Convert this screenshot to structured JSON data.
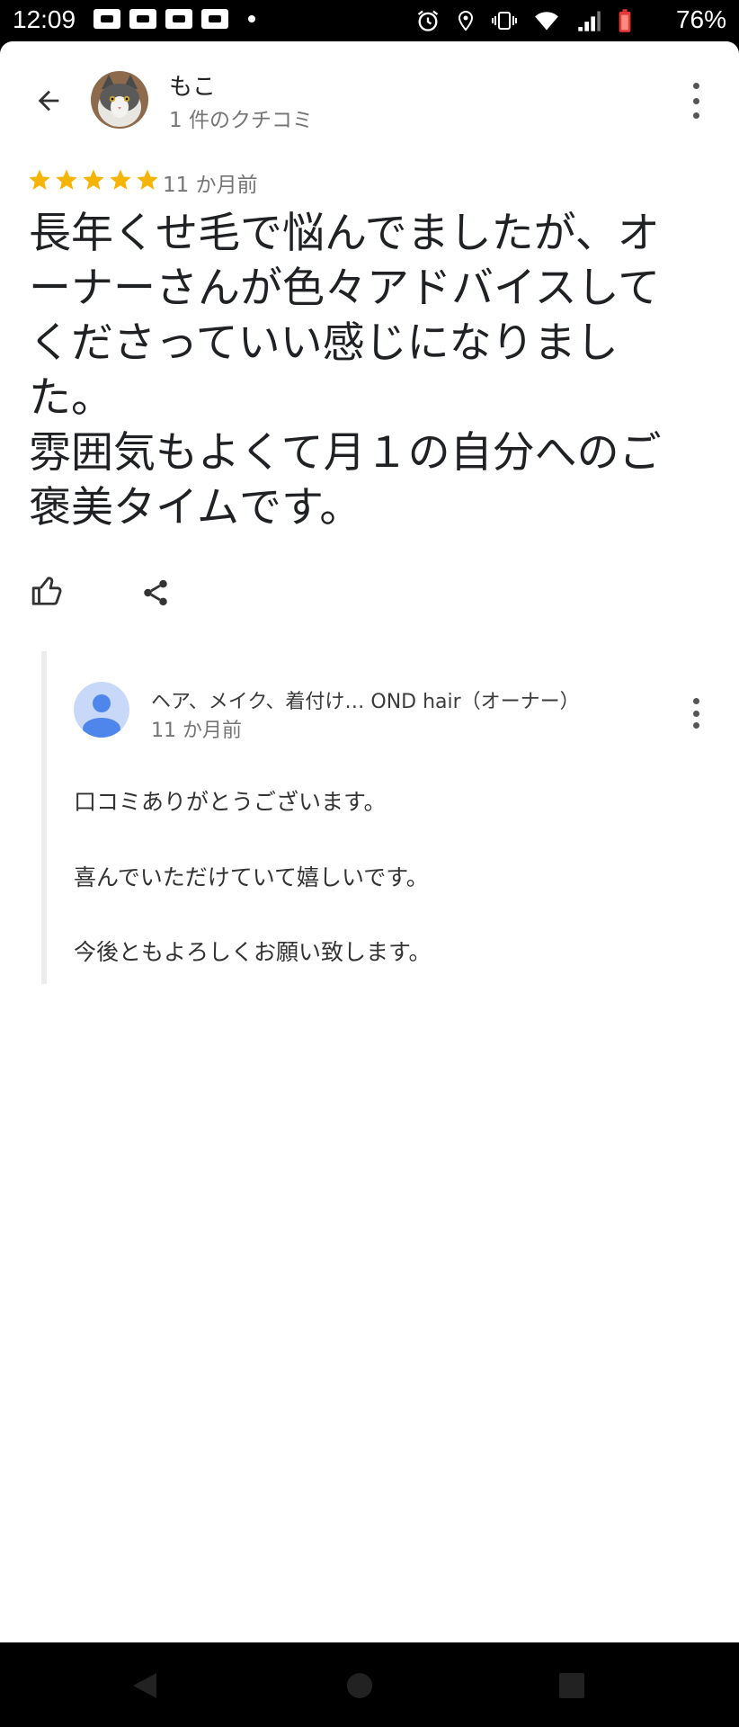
{
  "status_bar": {
    "time": "12:09",
    "battery": "76%",
    "notification_icons": [
      "au-mail-icon",
      "au-icon",
      "au-icon",
      "au-icon"
    ],
    "system_icons": [
      "alarm-icon",
      "location-icon",
      "vibrate-icon",
      "wifi-icon",
      "signal-icon",
      "battery-icon"
    ]
  },
  "header": {
    "reviewer_name": "もこ",
    "reviewer_meta": "1 件のクチコミ"
  },
  "review": {
    "rating": 5,
    "time": "11 か月前",
    "text": "長年くせ毛で悩んでましたが、オーナーさんが色々アドバイスしてくださっていい感じになりました。\n雰囲気もよくて月１の自分へのご褒美タイムです。"
  },
  "owner_reply": {
    "name": "ヘア、メイク、着付け… OND hair（オーナー）",
    "time": "11 か月前",
    "lines": [
      "口コミありがとうございます。",
      "喜んでいただけていて嬉しいです。",
      "今後ともよろしくお願い致します。"
    ]
  },
  "colors": {
    "star": "#f4b400",
    "owner_avatar_bg": "#c8d8f8",
    "owner_avatar_fg": "#4f86ec"
  }
}
